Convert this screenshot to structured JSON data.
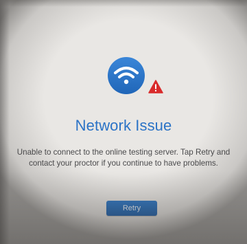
{
  "dialog": {
    "title": "Network Issue",
    "message": "Unable to connect to the online testing server. Tap Retry and contact your proctor if you continue to have problems.",
    "retry_label": "Retry"
  },
  "icons": {
    "status": "wifi-icon",
    "badge": "warning-icon"
  },
  "colors": {
    "accent": "#2b73c6",
    "icon_circle": "#2f7ad0",
    "warning": "#d92b2b",
    "button": "#1f62ae"
  }
}
